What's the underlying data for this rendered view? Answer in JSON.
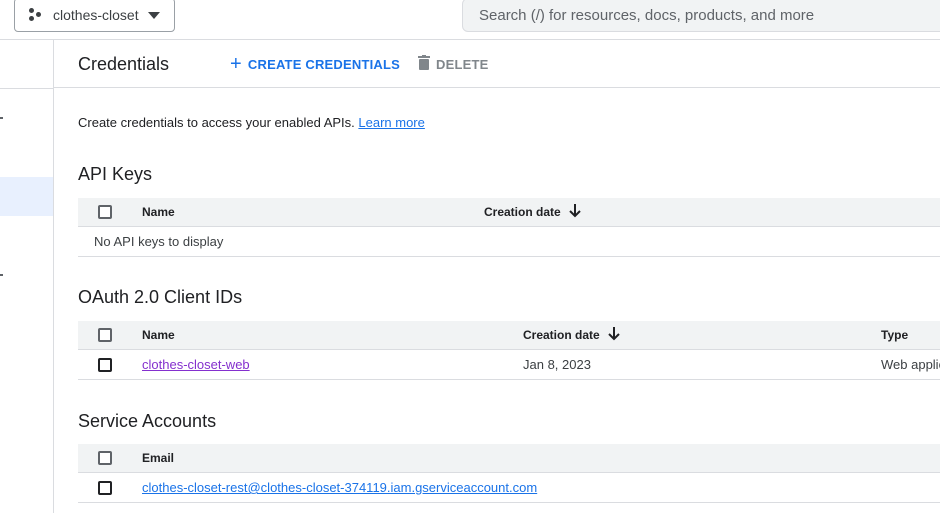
{
  "topbar": {
    "project_name": "clothes-closet",
    "search_placeholder": "Search (/) for resources, docs, products, and more"
  },
  "header": {
    "title": "Credentials",
    "create_label": "CREATE CREDENTIALS",
    "delete_label": "DELETE"
  },
  "intro": {
    "text": "Create credentials to access your enabled APIs.",
    "learn_more": "Learn more"
  },
  "api_keys": {
    "title": "API Keys",
    "columns": [
      "Name",
      "Creation date"
    ],
    "empty_message": "No API keys to display"
  },
  "oauth": {
    "title": "OAuth 2.0 Client IDs",
    "columns": [
      "Name",
      "Creation date",
      "Type"
    ],
    "rows": [
      {
        "name": "clothes-closet-web",
        "creation_date": "Jan 8, 2023",
        "type": "Web application"
      }
    ]
  },
  "service_accounts": {
    "title": "Service Accounts",
    "columns": [
      "Email"
    ],
    "rows": [
      {
        "email": "clothes-closet-rest@clothes-closet-374119.iam.gserviceaccount.com"
      }
    ]
  },
  "colors": {
    "accent": "#1a73e8",
    "visited_link": "#8430ce",
    "header_bg": "#f1f3f4",
    "nav_active_bg": "#e8f0fe"
  }
}
